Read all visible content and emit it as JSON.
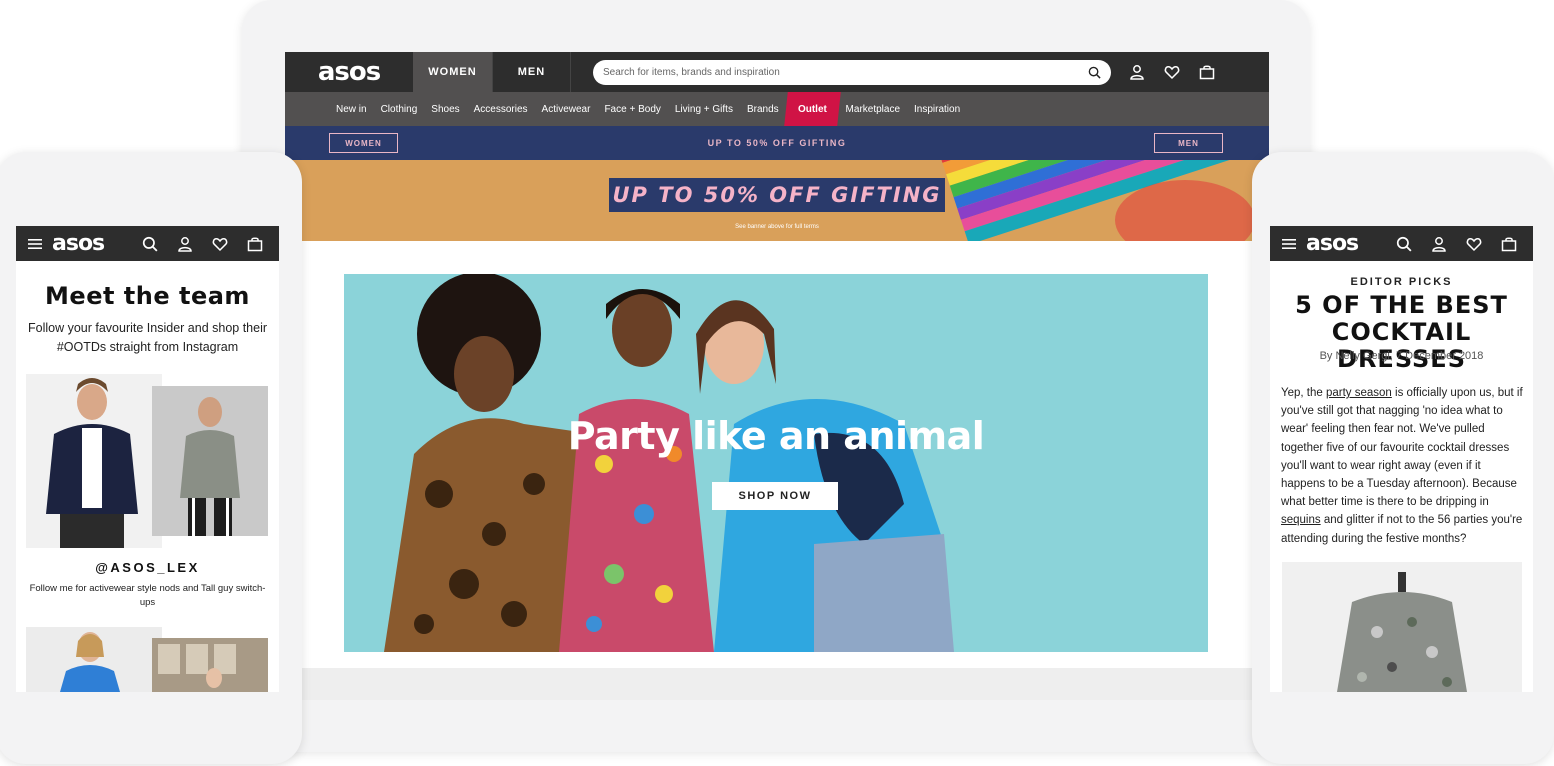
{
  "colors": {
    "nav_dark": "#2d2d2d",
    "nav_mid": "#525050",
    "outlet_red": "#d01345",
    "promo_navy": "#2a3a6b",
    "promo_pink": "#e9b6c6",
    "banner_orange": "#d9a05a",
    "hero_teal": "#8bd3d9"
  },
  "desktop": {
    "logo": "asos",
    "gender_tabs": [
      {
        "label": "WOMEN",
        "active": true
      },
      {
        "label": "MEN",
        "active": false
      }
    ],
    "search": {
      "placeholder": "Search for items, brands and inspiration",
      "icon": "search-icon"
    },
    "header_icons": [
      "account-icon",
      "heart-icon",
      "bag-icon"
    ],
    "categories": [
      {
        "label": "New in"
      },
      {
        "label": "Clothing"
      },
      {
        "label": "Shoes"
      },
      {
        "label": "Accessories"
      },
      {
        "label": "Activewear"
      },
      {
        "label": "Face + Body"
      },
      {
        "label": "Living + Gifts"
      },
      {
        "label": "Brands"
      },
      {
        "label": "Outlet",
        "highlight": true
      },
      {
        "label": "Marketplace"
      },
      {
        "label": "Inspiration"
      }
    ],
    "promo": {
      "women_label": "WOMEN",
      "text": "UP TO 50% OFF GIFTING",
      "men_label": "MEN"
    },
    "banner": {
      "title": "UP TO 50% OFF GIFTING",
      "small": "See banner above for full terms"
    },
    "hero": {
      "title": "Party like an animal",
      "cta": "SHOP NOW"
    }
  },
  "mobile_left": {
    "logo": "asos",
    "title": "Meet the team",
    "subtitle": "Follow your favourite Insider and shop their #OOTDs straight from Instagram",
    "handle": "@ASOS_LEX",
    "handle_desc": "Follow me for activewear style nods and Tall guy switch-ups"
  },
  "mobile_right": {
    "logo": "asos",
    "kicker": "EDITOR PICKS",
    "title": "5 OF THE BEST COCKTAIL DRESSES",
    "byline": "By Nelly Gergi, 7 December 2018",
    "body": {
      "p1": "Yep, the ",
      "link1": "party season",
      "p2": " is officially upon us, but if you've still got that nagging 'no idea what to wear' feeling then fear not. We've pulled together five of our favourite cocktail dresses you'll want to wear right away (even if it happens to be a Tuesday afternoon). Because what better time is there to be dripping in ",
      "link2": "sequins",
      "p3": " and glitter if not to the 56 parties you're attending during the festive months?"
    }
  }
}
